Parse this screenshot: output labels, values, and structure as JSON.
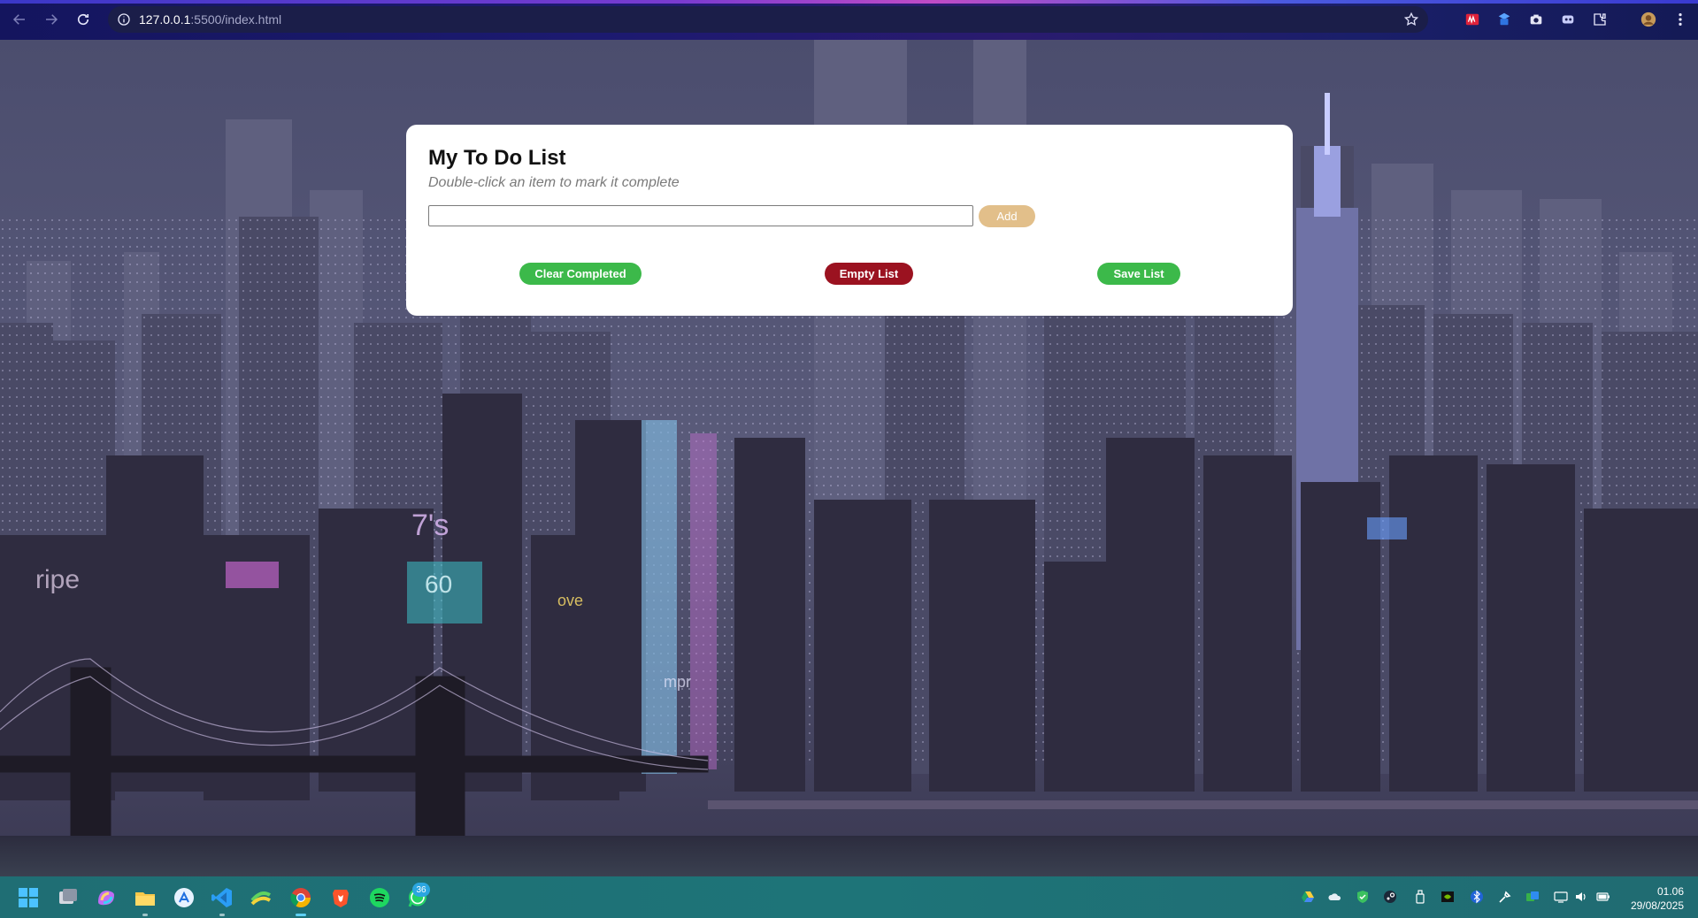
{
  "browser": {
    "url_host": "127.0.0.1",
    "url_path": ":5500/index.html"
  },
  "todo": {
    "title": "My To Do List",
    "subtitle": "Double-click an item to mark it complete",
    "input_value": "",
    "add_label": "Add",
    "clear_label": "Clear Completed",
    "empty_label": "Empty List",
    "save_label": "Save List",
    "colors": {
      "add": "#e2bf8a",
      "clear": "#3cb94a",
      "empty": "#9b1220",
      "save": "#3cb94a"
    }
  },
  "background": {
    "signs": [
      "7's",
      "60",
      "ripe",
      "mpr",
      "ove"
    ]
  },
  "taskbar": {
    "icons": [
      "windows-start-icon",
      "task-view-icon",
      "copilot-icon",
      "file-explorer-icon",
      "app-store-icon",
      "vscode-icon",
      "app-icon",
      "chrome-icon",
      "brave-icon",
      "spotify-icon",
      "whatsapp-icon"
    ],
    "whatsapp_badge": "36",
    "time": "01.06",
    "date": "29/08/2025"
  }
}
